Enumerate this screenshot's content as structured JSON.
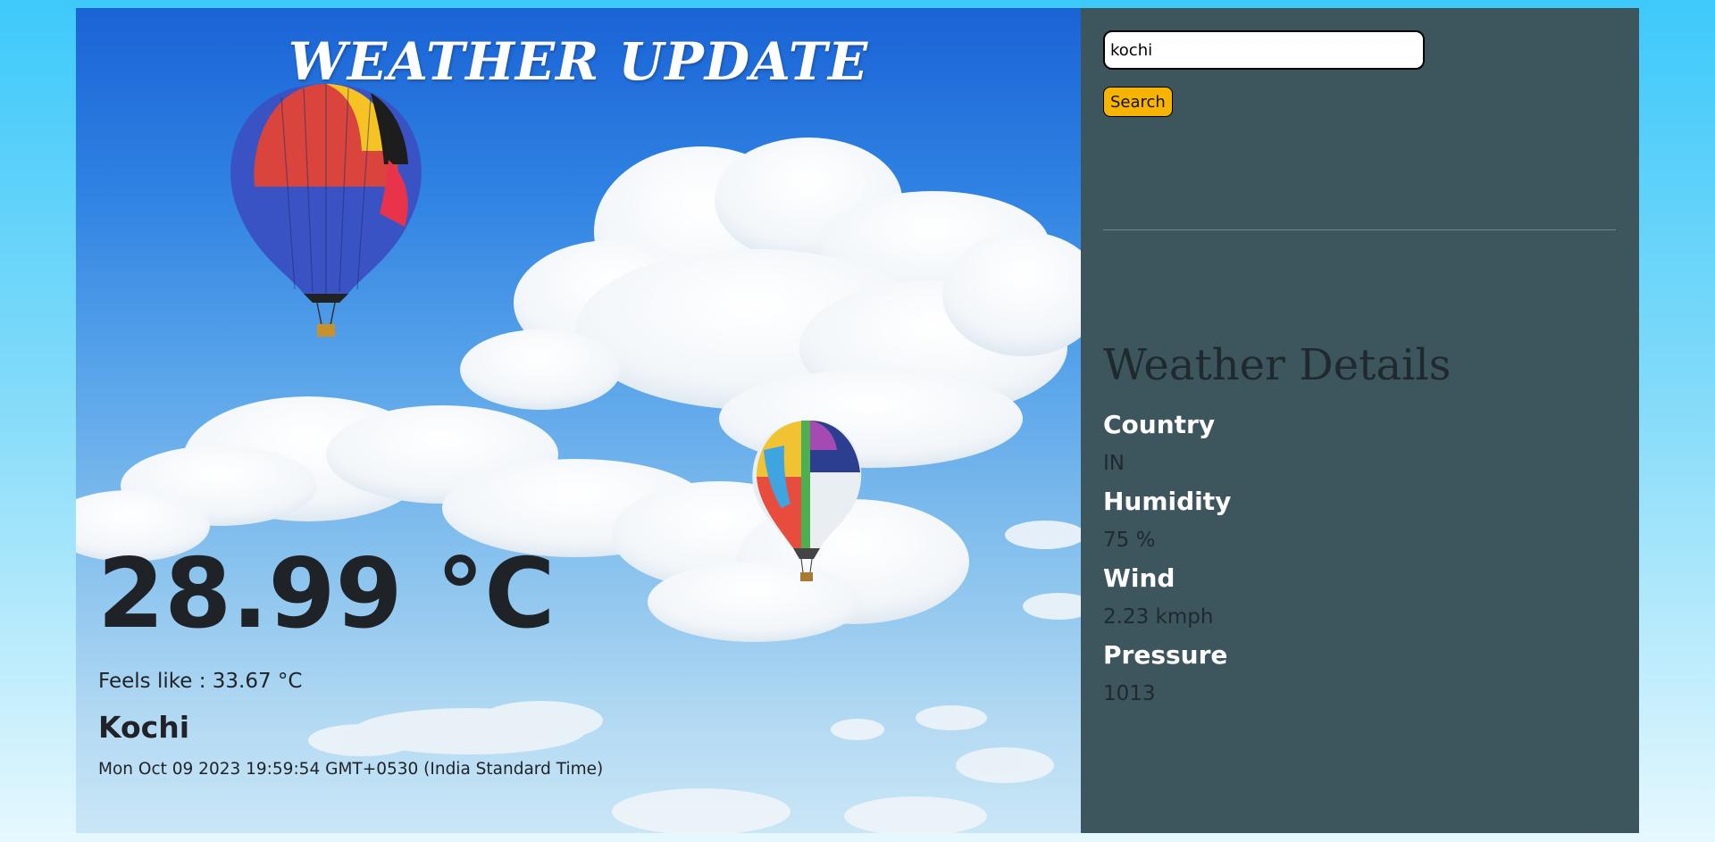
{
  "header": {
    "title": "WEATHER UPDATE"
  },
  "current": {
    "temperature": "28.99 °C",
    "feels_like": "Feels like : 33.67 °C",
    "city": "Kochi",
    "datetime": "Mon Oct 09 2023 19:59:54 GMT+0530 (India Standard Time)"
  },
  "search": {
    "value": "kochi",
    "button_label": "Search"
  },
  "details": {
    "title": "Weather Details",
    "items": [
      {
        "label": "Country",
        "value": "IN"
      },
      {
        "label": "Humidity",
        "value": "75 %"
      },
      {
        "label": "Wind",
        "value": "2.23 kmph"
      },
      {
        "label": "Pressure",
        "value": "1013"
      }
    ]
  },
  "colors": {
    "page_background": "#3ec9fb",
    "side_panel": "#3d565e",
    "search_button": "#f6b300",
    "title_text": "#ffffff"
  }
}
